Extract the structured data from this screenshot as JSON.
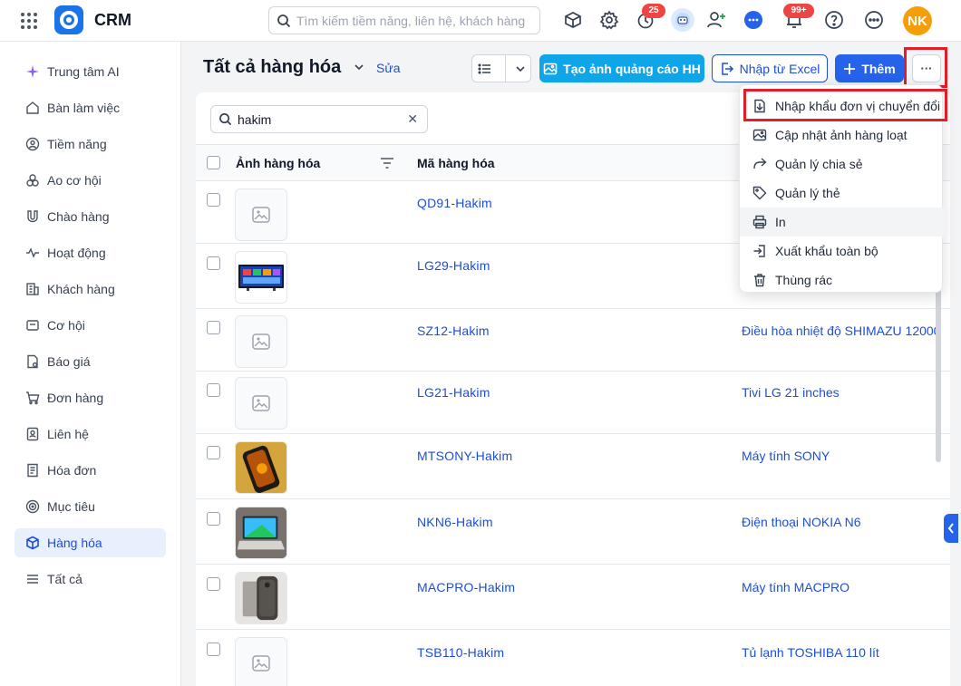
{
  "app": {
    "title": "CRM"
  },
  "search": {
    "placeholder": "Tìm kiếm tiềm năng, liên hệ, khách hàng"
  },
  "header": {
    "timer_badge": "25",
    "notification_badge": "99+",
    "user_initials": "NK"
  },
  "sidebar": {
    "items": [
      {
        "label": "Trung tâm AI",
        "icon": "sparkle-icon"
      },
      {
        "label": "Bàn làm việc",
        "icon": "home-icon"
      },
      {
        "label": "Tiềm năng",
        "icon": "target-user-icon"
      },
      {
        "label": "Ao cơ hội",
        "icon": "pool-icon"
      },
      {
        "label": "Chào hàng",
        "icon": "magnet-icon"
      },
      {
        "label": "Hoạt động",
        "icon": "activity-icon"
      },
      {
        "label": "Khách hàng",
        "icon": "building-icon"
      },
      {
        "label": "Cơ hội",
        "icon": "opportunity-icon"
      },
      {
        "label": "Báo giá",
        "icon": "quote-icon"
      },
      {
        "label": "Đơn hàng",
        "icon": "cart-icon"
      },
      {
        "label": "Liên hệ",
        "icon": "contact-icon"
      },
      {
        "label": "Hóa đơn",
        "icon": "invoice-icon"
      },
      {
        "label": "Mục tiêu",
        "icon": "goal-icon"
      },
      {
        "label": "Hàng hóa",
        "icon": "box-icon",
        "active": true
      },
      {
        "label": "Tất cả",
        "icon": "menu-icon"
      }
    ]
  },
  "page": {
    "title": "Tất cả hàng hóa",
    "edit_label": "Sửa"
  },
  "toolbar": {
    "create_ad_label": "Tạo ảnh quảng cáo HH",
    "import_excel_label": "Nhập từ Excel",
    "add_label": "Thêm",
    "more_label": "···"
  },
  "table": {
    "search_value": "hakim",
    "columns": {
      "image": "Ảnh hàng hóa",
      "code": "Mã hàng hóa"
    },
    "rows": [
      {
        "code": "QD91-Hakim",
        "name": "",
        "image": "placeholder"
      },
      {
        "code": "LG29-Hakim",
        "name": "",
        "image": "tv"
      },
      {
        "code": "SZ12-Hakim",
        "name": "Điều hòa nhiệt độ SHIMAZU 12000",
        "image": "placeholder"
      },
      {
        "code": "LG21-Hakim",
        "name": "Tivi LG 21 inches",
        "image": "placeholder"
      },
      {
        "code": "MTSONY-Hakim",
        "name": "Máy tính SONY",
        "image": "phone-gold"
      },
      {
        "code": "NKN6-Hakim",
        "name": "Điện thoại NOKIA N6",
        "image": "laptop"
      },
      {
        "code": "MACPRO-Hakim",
        "name": "Máy tính MACPRO",
        "image": "phone-dark"
      },
      {
        "code": "TSB110-Hakim",
        "name": "Tủ lạnh TOSHIBA 110 lít",
        "image": "placeholder"
      }
    ]
  },
  "dropdown": {
    "items": [
      {
        "label": "Nhập khẩu đơn vị chuyển đổi",
        "icon": "import-units-icon"
      },
      {
        "label": "Cập nhật ảnh hàng loạt",
        "icon": "image-icon"
      },
      {
        "label": "Quản lý chia sẻ",
        "icon": "share-icon"
      },
      {
        "label": "Quản lý thẻ",
        "icon": "tag-icon"
      },
      {
        "label": "In",
        "icon": "printer-icon"
      },
      {
        "label": "Xuất khẩu toàn bộ",
        "icon": "export-icon"
      },
      {
        "label": "Thùng rác",
        "icon": "trash-icon"
      }
    ]
  },
  "colors": {
    "accent": "#2563eb",
    "link": "#1d4ed8",
    "highlight": "#e11d2a",
    "cyan": "#0ea5e9"
  }
}
